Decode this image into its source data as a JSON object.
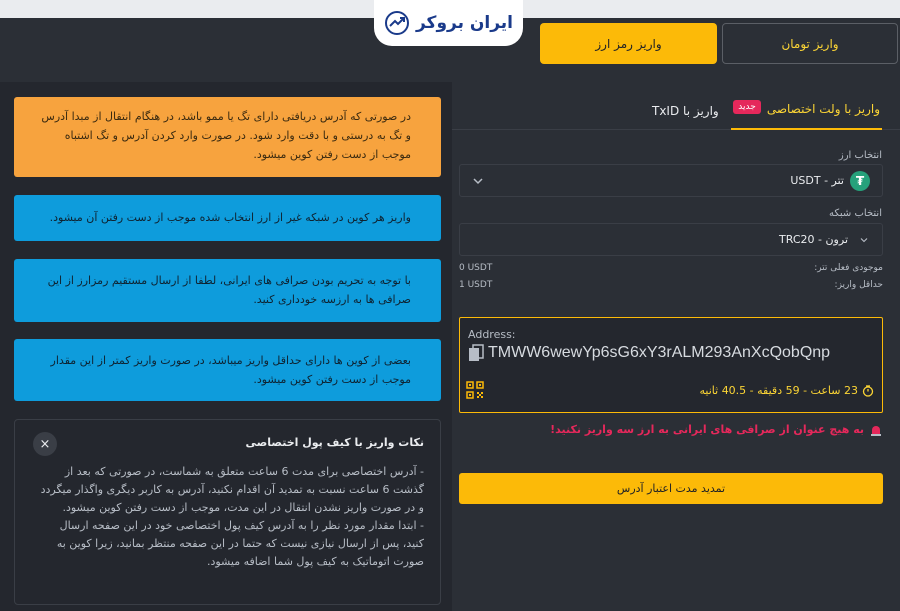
{
  "header": {
    "logo_text": "ایران بروکر",
    "toman_button": "واریز تومان",
    "crypto_button": "واریز رمز ارز"
  },
  "tabs": {
    "wallet": "واریز با ولت اختصاصی",
    "badge": "جدید",
    "txid": "واریز با TxID"
  },
  "form": {
    "currency_label": "انتخاب ارز",
    "currency_value": "تتر - USDT",
    "network_label": "انتخاب شبکه",
    "network_value": "ترون - TRC20",
    "balance_label": "موجودی فعلی تتر:",
    "balance_value": "0 USDT",
    "min_label": "حداقل واریز:",
    "min_value": "1 USDT"
  },
  "address": {
    "label": "Address:",
    "value": "TMWW6wewYp6sG6xY3rALM293AnXcQobQnp",
    "timer": "23 ساعت - 59 دقیقه - 40.5 ثانیه"
  },
  "warning": "به هیچ عنوان از صرافی های ایرانی به ارز سه واریز نکنید!",
  "extend_button": "تمدید مدت اعتبار آدرس",
  "notes": {
    "orange": "در صورتی که آدرس دریافتی دارای تگ یا ممو باشد، در هنگام انتقال از مبدا آدرس و تگ به درستی و با دقت وارد شود. در صورت وارد کردن آدرس و تگ اشتباه موجب از دست رفتن کوین میشود.",
    "blue1": "واریز هر کوین در شبکه غیر از ارز انتخاب شده موجب از دست رفتن آن میشود.",
    "blue2": "با توجه به تحریم بودن صرافی های ایرانی، لطفا از ارسال مستقیم رمزارز از این صرافی ها به ارزسه خودداری کنید.",
    "blue3": "بعضی از کوین ها دارای حداقل واریز میباشد، در صورت واریز کمتر از این مقدار موجب از دست رفتن کوین میشود."
  },
  "tips": {
    "title": "نکات واریز با کیف پول اختصاصی",
    "body1": "- آدرس اختصاصی برای مدت 6 ساعت متعلق به شماست، در صورتی که بعد از گذشت 6 ساعت نسبت به تمدید آن اقدام نکنید، آدرس به کاربر دیگری واگذار میگردد و در صورت واریز نشدن انتقال در این مدت، موجب از دست رفتن کوین میشود.",
    "body2": "- ابتدا مقدار مورد نظر را به آدرس کیف پول اختصاصی خود در این صفحه ارسال کنید، پس از ارسال نیازی نیست که حتما در این صفحه منتظر بمانید، زیرا کوین به صورت اتوماتیک به کیف پول شما اضافه میشود.",
    "close": "×"
  },
  "icons": {
    "logo": "chart-logo-icon",
    "tether": "tether-icon",
    "chevron": "chevron-down-icon",
    "copy": "copy-icon",
    "qr": "qr-code-icon",
    "timer": "timer-icon",
    "siren": "siren-icon",
    "close": "close-icon"
  },
  "colors": {
    "accent": "#fcba08",
    "alert": "#e5285b",
    "info_blue": "#0e9cdc",
    "warn_orange": "#f7a33e"
  }
}
